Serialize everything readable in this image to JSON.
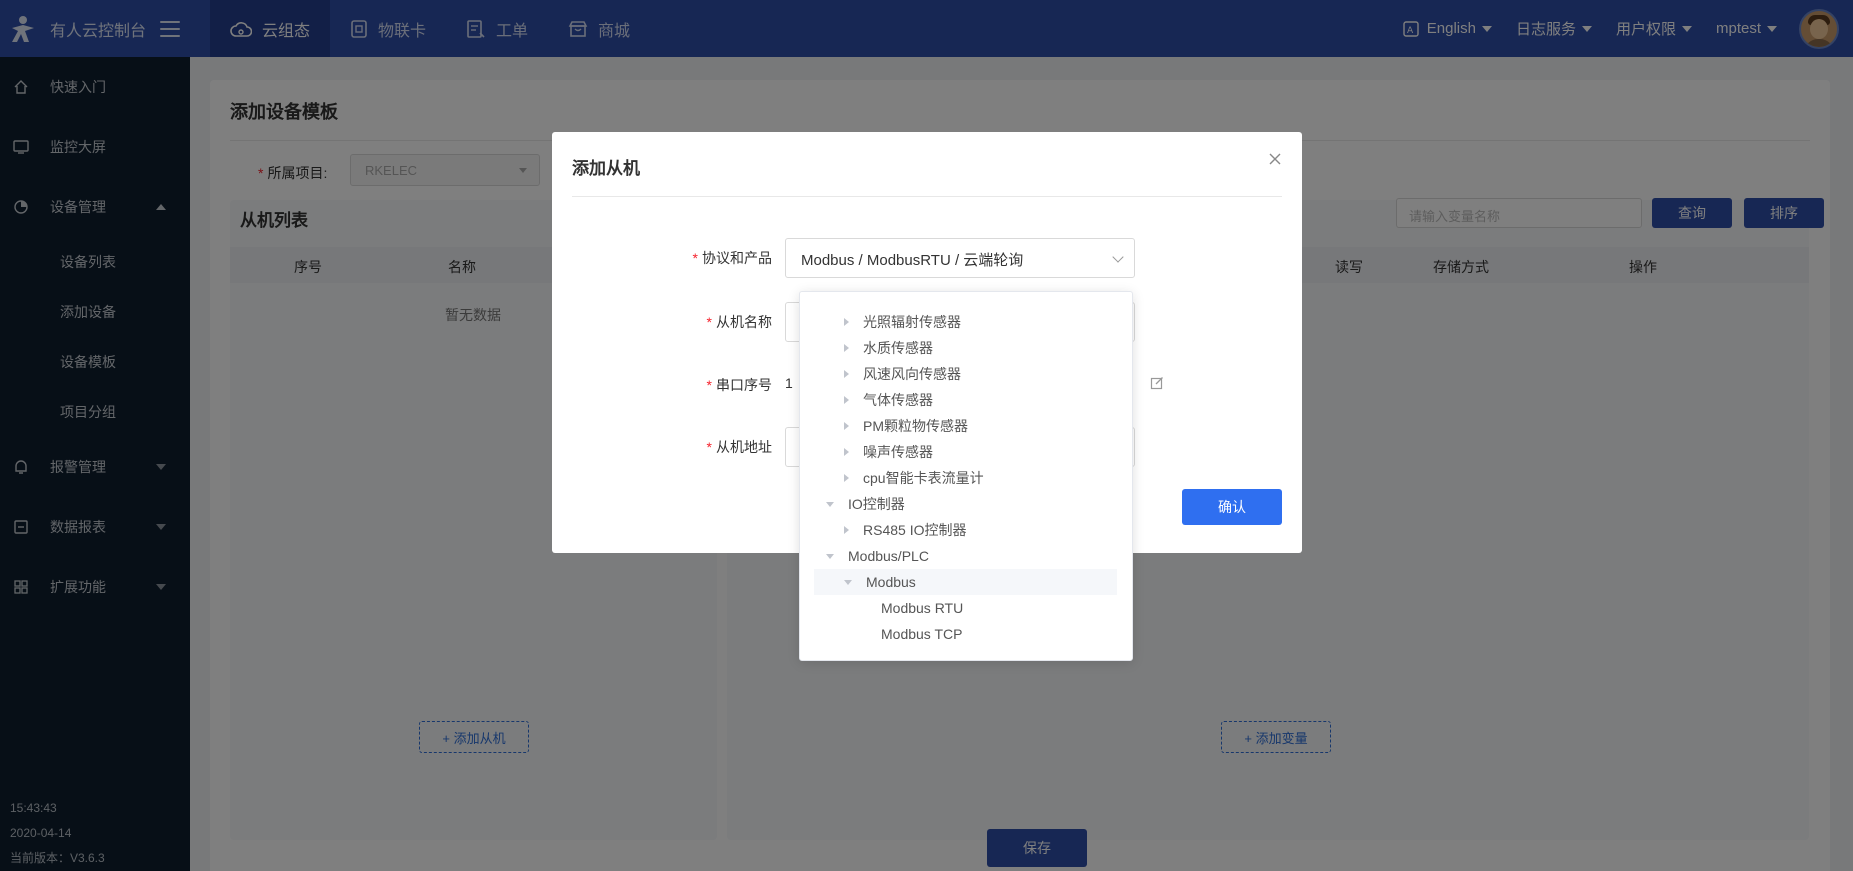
{
  "topbar": {
    "brand_title": "有人云控制台",
    "nav": [
      {
        "label": "云组态",
        "icon": "cloud-icon"
      },
      {
        "label": "物联卡",
        "icon": "card-icon"
      },
      {
        "label": "工单",
        "icon": "ticket-icon"
      },
      {
        "label": "商城",
        "icon": "shop-icon"
      }
    ],
    "language": "English",
    "log_service": "日志服务",
    "user_perm": "用户权限",
    "username": "mptest"
  },
  "sidebar": {
    "items": [
      {
        "label": "快速入门",
        "icon": "home-icon"
      },
      {
        "label": "监控大屏",
        "icon": "monitor-icon"
      },
      {
        "label": "设备管理",
        "icon": "device-icon"
      },
      {
        "label": "报警管理",
        "icon": "bell-icon"
      },
      {
        "label": "数据报表",
        "icon": "report-icon"
      },
      {
        "label": "扩展功能",
        "icon": "apps-icon"
      }
    ],
    "sub_items": [
      "设备列表",
      "添加设备",
      "设备模板",
      "项目分组"
    ],
    "time": "15:43:43",
    "date": "2020-04-14",
    "version": "当前版本：V3.6.3"
  },
  "page": {
    "title": "添加设备模板",
    "project_label": "所属项目:",
    "project_value": "RKELEC",
    "slave_list_title": "从机列表",
    "left_columns": [
      "序号",
      "名称"
    ],
    "right_columns": [
      "读写",
      "存储方式",
      "操作"
    ],
    "no_data": "暂无数据",
    "search_placeholder": "请输入变量名称",
    "query_button": "查询",
    "sort_button": "排序",
    "add_slave": "+ 添加从机",
    "add_variable": "+ 添加变量",
    "save": "保存"
  },
  "modal": {
    "title": "添加从机",
    "labels": {
      "protocol": "协议和产品",
      "slave_name": "从机名称",
      "serial_no": "串口序号",
      "slave_addr": "从机地址"
    },
    "protocol_value": "Modbus / ModbusRTU / 云端轮询",
    "serial_value": "1",
    "confirm": "确认"
  },
  "cascader": {
    "nodes": [
      {
        "label": "光照辐射传感器",
        "level": 2,
        "expander": "right"
      },
      {
        "label": "水质传感器",
        "level": 2,
        "expander": "right"
      },
      {
        "label": "风速风向传感器",
        "level": 2,
        "expander": "right"
      },
      {
        "label": "气体传感器",
        "level": 2,
        "expander": "right"
      },
      {
        "label": "PM颗粒物传感器",
        "level": 2,
        "expander": "right"
      },
      {
        "label": "噪声传感器",
        "level": 2,
        "expander": "right"
      },
      {
        "label": "cpu智能卡表流量计",
        "level": 2,
        "expander": "right"
      },
      {
        "label": "IO控制器",
        "level": 1,
        "expander": "down"
      },
      {
        "label": "RS485 IO控制器",
        "level": 2,
        "expander": "right"
      },
      {
        "label": "Modbus/PLC",
        "level": 1,
        "expander": "down"
      },
      {
        "label": "Modbus",
        "level": 2,
        "expander": "down",
        "highlight": true
      },
      {
        "label": "Modbus RTU",
        "level": 3,
        "expander": "none"
      },
      {
        "label": "Modbus TCP",
        "level": 3,
        "expander": "none"
      }
    ]
  }
}
